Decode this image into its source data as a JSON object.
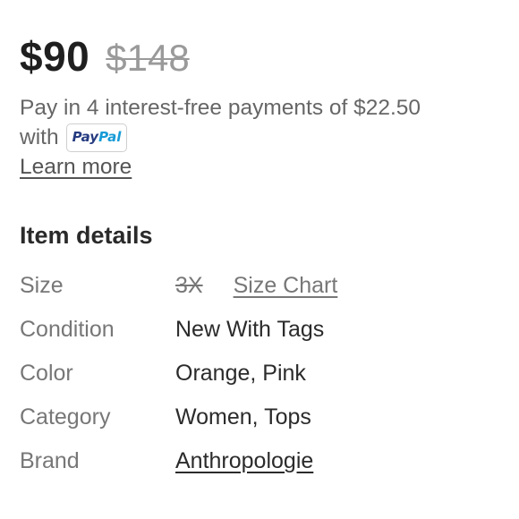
{
  "price": {
    "current": "$90",
    "original": "$148"
  },
  "installment": {
    "text": "Pay in 4 interest-free payments of $22.50",
    "with_label": "with",
    "paypal_pay": "Pay",
    "paypal_pal": "Pal",
    "paypal_colors": {
      "pay": "#253b80",
      "pal": "#179bd7"
    }
  },
  "learn_more": "Learn more",
  "item_details": {
    "title": "Item details",
    "size": {
      "label": "Size",
      "value": "3X",
      "size_chart_link": "Size Chart"
    },
    "condition": {
      "label": "Condition",
      "value": "New With Tags"
    },
    "color": {
      "label": "Color",
      "value": "Orange, Pink"
    },
    "category": {
      "label": "Category",
      "value": "Women, Tops"
    },
    "brand": {
      "label": "Brand",
      "value": "Anthropologie"
    }
  }
}
